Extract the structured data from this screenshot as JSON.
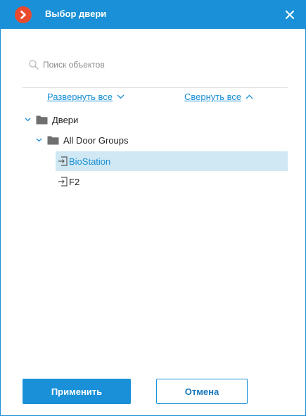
{
  "window": {
    "title": "Выбор двери",
    "accent_color": "#1a90d8",
    "logo_color": "#ea4b2e",
    "logo_icon": "chevron-right-icon",
    "close_icon": "close-icon"
  },
  "search": {
    "placeholder": "Поиск объектов",
    "value": "",
    "icon": "search-icon"
  },
  "links": {
    "expand_all": "Развернуть все",
    "collapse_all": "Свернуть все"
  },
  "tree": {
    "root": {
      "label": "Двери",
      "expanded": true,
      "icon": "folder-icon"
    },
    "group": {
      "label": "All Door Groups",
      "expanded": true,
      "icon": "folder-icon"
    },
    "doors": [
      {
        "label": "BioStation",
        "selected": true,
        "icon": "door-icon"
      },
      {
        "label": "F2",
        "selected": false,
        "icon": "door-icon"
      }
    ],
    "selected_background": "#cfe8f3"
  },
  "buttons": {
    "apply": "Применить",
    "cancel": "Отмена"
  }
}
